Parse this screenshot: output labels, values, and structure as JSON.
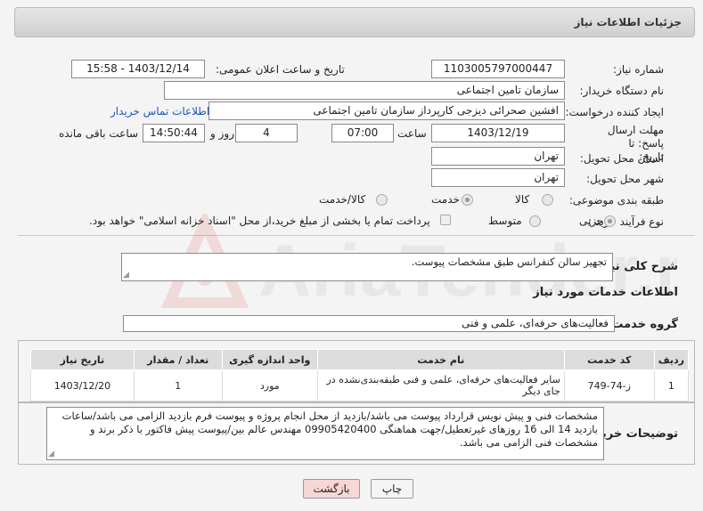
{
  "header": {
    "title": "جزئیات اطلاعات نیاز"
  },
  "fields": {
    "need_number_label": "شماره نیاز:",
    "need_number": "1103005797000447",
    "announce_label": "تاریخ و ساعت اعلان عمومی:",
    "announce_value": "1403/12/14 - 15:58",
    "buyer_org_label": "نام دستگاه خریدار:",
    "buyer_org": "سازمان تامین اجتماعی",
    "creator_label": "ایجاد کننده درخواست:",
    "creator": "افشین صحرائی دیزجی کارپرداز سازمان تامین اجتماعی",
    "contact_link": "اطلاعات تماس خریدار",
    "deadline_label": "مهلت ارسال پاسخ: تا تاریخ:",
    "deadline_date": "1403/12/19",
    "time_label": "ساعت",
    "deadline_time": "07:00",
    "days_value": "4",
    "days_label": "روز و",
    "remaining_time": "14:50:44",
    "remaining_label": "ساعت باقی مانده",
    "province_label": "استان محل تحویل:",
    "province": "تهران",
    "city_label": "شهر محل تحویل:",
    "city": "تهران",
    "category_label": "طبقه بندی موضوعی:",
    "category_options": [
      "کالا",
      "خدمت",
      "کالا/خدمت"
    ],
    "category_selected": "خدمت",
    "process_label": "نوع فرآیند خرید :",
    "process_options": [
      "جزیی",
      "متوسط"
    ],
    "process_selected": "جزیی",
    "payment_note": "پرداخت تمام یا بخشی از مبلغ خرید،از محل \"اسناد خزانه اسلامی\" خواهد بود."
  },
  "summary": {
    "label": "شرح کلی نیاز:",
    "text": "تجهیز سالن کنفرانس طبق مشخصات پیوست."
  },
  "services": {
    "section_title": "اطلاعات خدمات مورد نیاز",
    "group_label": "گروه خدمت:",
    "group_value": "فعالیت‌های حرفه‌ای، علمی و فنی",
    "columns": [
      "ردیف",
      "کد خدمت",
      "نام خدمت",
      "واحد اندازه گیری",
      "تعداد / مقدار",
      "تاریخ نیاز"
    ],
    "rows": [
      [
        "1",
        "ز-74-749",
        "سایر فعالیت‌های حرفه‌ای، علمی و فنی طبقه‌بندی‌نشده در جای دیگر",
        "مورد",
        "1",
        "1403/12/20"
      ]
    ]
  },
  "buyer_notes": {
    "label": "توضیحات خریدار:",
    "text": "مشخصات فنی و پیش نویس قرارداد پیوست می باشد/بازدید از محل انجام پروژه و پیوست فرم بازدید الزامی می باشد/ساعات بازدید 14 الی 16 روزهای غیرتعطیل/جهت هماهنگی 09905420400 مهندس عالم بین/پیوست پیش فاکتور با ذکر برند و مشخصات فنی الزامی می باشد."
  },
  "buttons": {
    "print": "چاپ",
    "back": "بازگشت"
  },
  "watermark": {
    "text": "AriaTender.neT"
  },
  "colors": {
    "link": "#1a56c4",
    "back_button": "#f7d6d6",
    "watermark": "#d92b2b"
  }
}
